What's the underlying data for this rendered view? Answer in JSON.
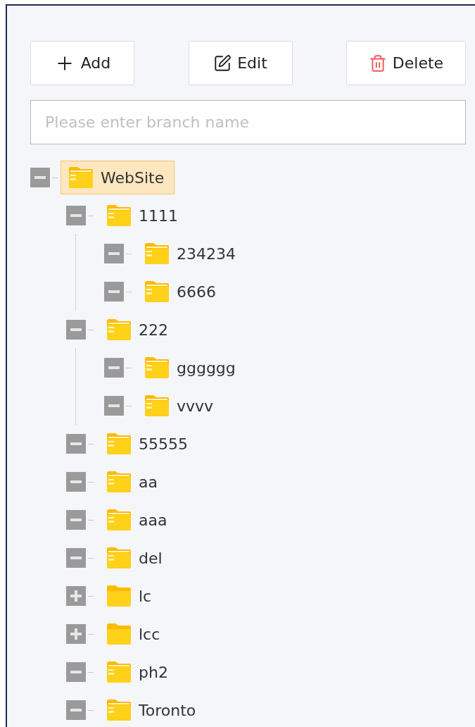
{
  "toolbar": {
    "buttons": [
      {
        "kind": "add",
        "label": "Add"
      },
      {
        "kind": "edit",
        "label": "Edit"
      },
      {
        "kind": "delete",
        "label": "Delete"
      }
    ]
  },
  "search": {
    "placeholder": "Please enter branch name"
  },
  "tree": [
    {
      "label": "WebSite",
      "expanded": true,
      "selected": true,
      "children": [
        {
          "label": "1111",
          "expanded": true,
          "selected": false,
          "children": [
            {
              "label": "234234",
              "expanded": true,
              "selected": false
            },
            {
              "label": "6666",
              "expanded": true,
              "selected": false
            }
          ]
        },
        {
          "label": "222",
          "expanded": true,
          "selected": false,
          "children": [
            {
              "label": "gggggg",
              "expanded": true,
              "selected": false
            },
            {
              "label": "vvvv",
              "expanded": true,
              "selected": false
            }
          ]
        },
        {
          "label": "55555",
          "expanded": true,
          "selected": false
        },
        {
          "label": "aa",
          "expanded": true,
          "selected": false
        },
        {
          "label": "aaa",
          "expanded": true,
          "selected": false
        },
        {
          "label": "del",
          "expanded": true,
          "selected": false
        },
        {
          "label": "lc",
          "expanded": false,
          "selected": false
        },
        {
          "label": "lcc",
          "expanded": false,
          "selected": false
        },
        {
          "label": "ph2",
          "expanded": true,
          "selected": false
        },
        {
          "label": "Toronto",
          "expanded": true,
          "selected": false
        }
      ]
    }
  ]
}
